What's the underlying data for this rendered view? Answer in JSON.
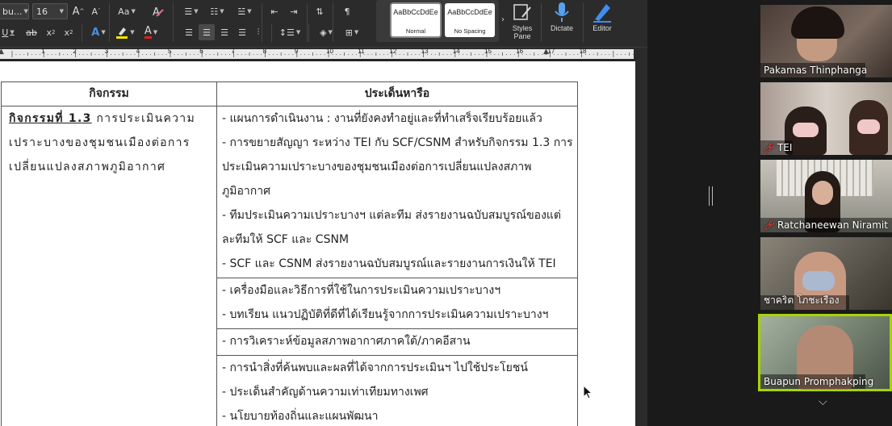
{
  "ribbon": {
    "font_name": "bu...",
    "font_size": "16",
    "grow_font": "A",
    "shrink_font": "A",
    "change_case": "Aa",
    "bold_u": "U",
    "strike": "ab",
    "subscript": "x",
    "superscript": "x",
    "text_effects": "A",
    "font_color": "A",
    "styles": [
      {
        "sample": "AaBbCcDdEe",
        "name": "Normal"
      },
      {
        "sample": "AaBbCcDdEe",
        "name": "No Spacing"
      }
    ],
    "styles_pane": "Styles\nPane",
    "dictate": "Dictate",
    "editor": "Editor"
  },
  "ruler": {
    "numbers": [
      "1",
      "2",
      "3",
      "4",
      "5",
      "6",
      "7",
      "8",
      "9",
      "10",
      "11",
      "12",
      "13",
      "14",
      "15",
      "16",
      "17",
      "18"
    ]
  },
  "table": {
    "header": {
      "col1": "กิจกรรม",
      "col2": "ประเด็นหารือ"
    },
    "row1": {
      "activity_title": "กิจกรรมที่ 1.3",
      "activity_text_1": " การประเมินความ",
      "activity_text_2": "เปราะบางของชุมชนเมืองต่อการ",
      "activity_text_3": "เปลี่ยนแปลงสภาพภูมิอากาศ",
      "issues_a": [
        "- แผนการดำเนินงาน : งานที่ยังคงทำอยู่และที่ทำเสร็จเรียบร้อยแล้ว",
        "- การขยายสัญญา ระหว่าง TEI กับ SCF/CSNM สำหรับกิจกรรม 1.3 การ",
        "ประเมินความเปราะบางของชุมชนเมืองต่อการเปลี่ยนแปลงสภาพ",
        "ภูมิอากาศ",
        "- ทีมประเมินความเปราะบางฯ แต่ละทีม ส่งรายงานฉบับสมบูรณ์ของแต่",
        "ละทีมให้ SCF และ CSNM",
        "- SCF และ CSNM ส่งรายงานฉบับสมบูรณ์และรายงานการเงินให้ TEI"
      ],
      "issues_b": [
        "- เครื่องมือและวิธีการที่ใช้ในการประเมินความเปราะบางฯ",
        "- บทเรียน แนวปฏิบัติที่ดีที่ได้เรียนรู้จากการประเมินความเปราะบางฯ"
      ],
      "issues_c": [
        "- การวิเคราะห์ข้อมูลสภาพอากาศภาคใต้/ภาคอีสาน"
      ],
      "issues_d": [
        "- การนำสิ่งที่ค้นพบและผลที่ได้จากการประเมินฯ ไปใช้ประโยชน์",
        "- ประเด็นสำคัญด้านความเท่าเทียมทางเพศ",
        "- นโยบายท้องถิ่นและแผนพัฒนา"
      ]
    }
  },
  "participants": [
    {
      "name": "Pakamas Thinphanga",
      "muted": false,
      "speaking": false,
      "bg": "#5a4a42"
    },
    {
      "name": "TEI",
      "muted": true,
      "speaking": false,
      "bg": "#8c7f78"
    },
    {
      "name": "Ratchaneewan Niramit",
      "muted": true,
      "speaking": false,
      "bg": "#9a9a8e"
    },
    {
      "name": "ชาคริต โภชะเรือง",
      "muted": false,
      "speaking": false,
      "bg": "#6a655c"
    },
    {
      "name": "Buapun Promphakping",
      "muted": false,
      "speaking": true,
      "bg": "#7d8a7a"
    }
  ],
  "colors": {
    "speaking_outline": "#a7d400",
    "muted_icon": "#e23b3b",
    "ribbon_bg": "#2b2b2b",
    "editor_icon": "#3f8ef0",
    "dictate_icon": "#5aa0f0"
  }
}
